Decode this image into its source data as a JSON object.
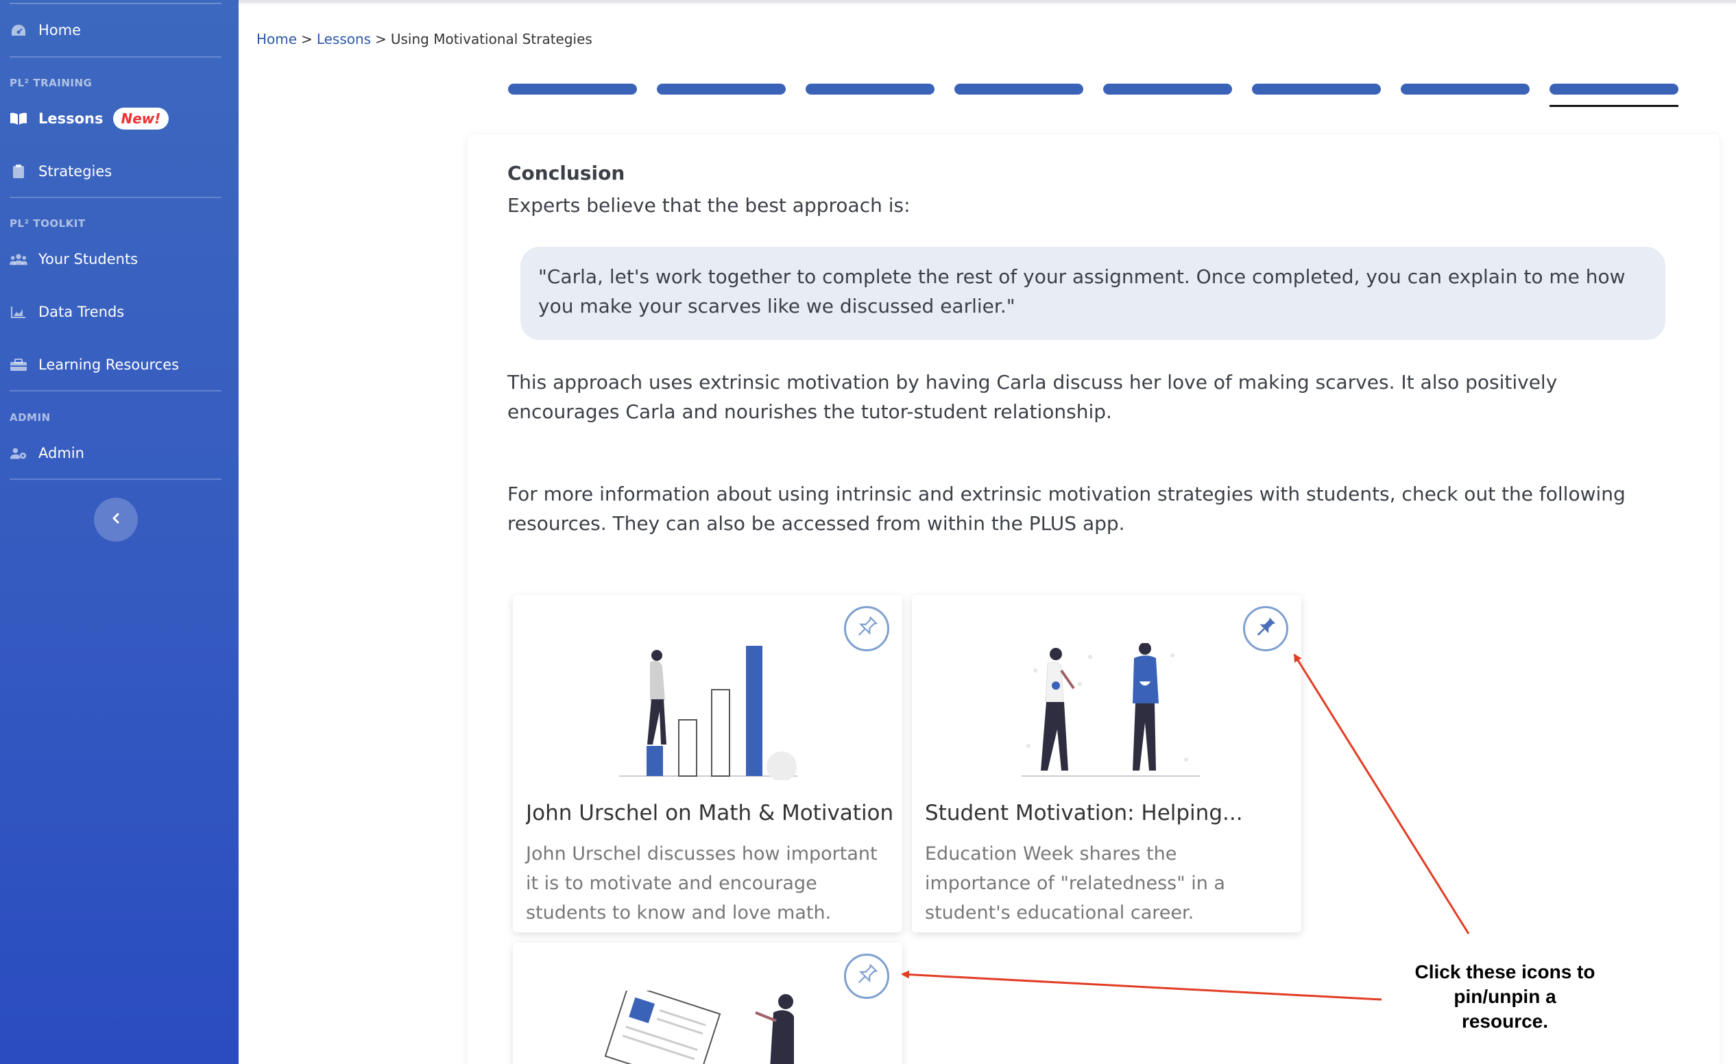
{
  "sidebar": {
    "items": {
      "home": {
        "label": "Home",
        "icon": "dashboard-icon"
      },
      "lessons": {
        "label": "Lessons",
        "icon": "book-icon",
        "badge": "New!"
      },
      "strategies": {
        "label": "Strategies",
        "icon": "clipboard-icon"
      },
      "students": {
        "label": "Your Students",
        "icon": "users-icon"
      },
      "trends": {
        "label": "Data Trends",
        "icon": "area-chart-icon"
      },
      "resources": {
        "label": "Learning Resources",
        "icon": "toolbox-icon"
      },
      "admin": {
        "label": "Admin",
        "icon": "users-cog-icon"
      }
    },
    "sections": {
      "training": "PL² TRAINING",
      "toolkit": "PL² TOOLKIT",
      "admin": "ADMIN"
    },
    "collapse_icon": "chevron-left-icon"
  },
  "breadcrumb": {
    "home": "Home",
    "lessons": "Lessons",
    "current": "Using Motivational Strategies",
    "separator": ">"
  },
  "progress": {
    "total_steps": 8,
    "current_step": 8
  },
  "content": {
    "heading": "Conclusion",
    "intro": "Experts believe that the best approach is:",
    "quote": "\"Carla, let's work together to complete the rest of your assignment. Once completed, you can explain to me how you make your scarves like we discussed earlier.\"",
    "paragraph1": "This approach uses extrinsic motivation by having Carla discuss her love of making scarves. It also positively encourages Carla and nourishes the tutor-student relationship.",
    "paragraph2": "For more information about using intrinsic and extrinsic motivation strategies with students, check out the following resources. They can also be accessed from within the PLUS app."
  },
  "resources": [
    {
      "title": "John Urschel on Math & Motivation",
      "description": "John Urschel discusses how important it is to motivate and encourage students to know and love math.",
      "pinned": false
    },
    {
      "title": "Student Motivation: Helping...",
      "description": "Education Week shares the importance of \"relatedness\" in a student's educational career.",
      "pinned": true
    },
    {
      "title": "",
      "description": "",
      "pinned": false
    }
  ],
  "annotation": {
    "text": "Click these icons to pin/unpin a resource."
  },
  "colors": {
    "sidebar": "#3459c0",
    "accent": "#3a63b8",
    "annotation_arrow": "#e23c24",
    "badge_text": "#e33333"
  }
}
